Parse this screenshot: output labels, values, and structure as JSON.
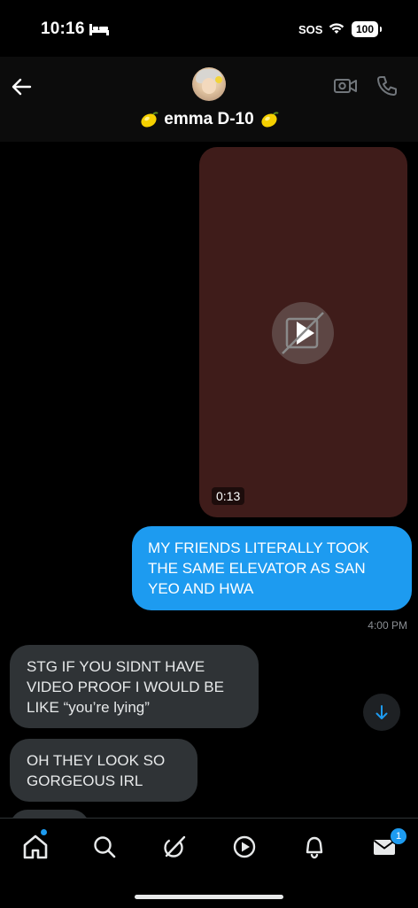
{
  "status_bar": {
    "time": "10:16",
    "sos": "SOS",
    "battery": "100"
  },
  "header": {
    "contact_name": "emma D-10",
    "name_emoji": "lemon"
  },
  "messages": {
    "video": {
      "duration": "0:13"
    },
    "outgoing_1": {
      "text": "MY FRIENDS LITERALLY TOOK THE SAME ELEVATOR AS SAN YEO AND HWA",
      "time": "4:00 PM"
    },
    "incoming_1": {
      "text": "STG IF YOU SIDNT HAVE VIDEO PROOF I WOULD BE LIKE “you’re lying”"
    },
    "incoming_2": {
      "text": "OH THEY LOOK SO GORGEOUS IRL"
    }
  },
  "bottom_nav": {
    "items": [
      "home",
      "search",
      "grok",
      "video",
      "notifications",
      "messages"
    ],
    "messages_badge": "1"
  },
  "colors": {
    "accent": "#1d9bf0",
    "incoming_bubble": "#2f3336",
    "video_bg": "#3f1c1a"
  }
}
